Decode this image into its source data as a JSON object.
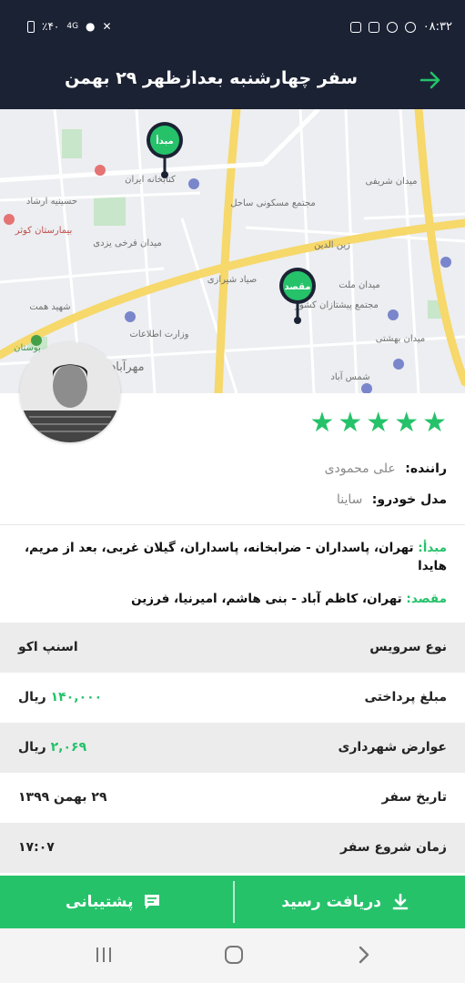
{
  "status_bar": {
    "time": "۰۸:۳۲",
    "battery": "٪۴۰",
    "network": "4G"
  },
  "header": {
    "title": "سفر چهارشنبه بعدازظهر ۲۹ بهمن",
    "back_icon": "arrow-right-icon"
  },
  "map": {
    "origin_marker": "مبدأ",
    "destination_marker": "مقصد",
    "places": [
      "حسینیه ارشاد",
      "بیمارستان کوثر",
      "میدان شریفی",
      "مجتمع مسکونی ساحل",
      "زین الدین",
      "شهید همت",
      "میدان ملت",
      "مجتمع پیشتازان کشور",
      "میدان بهشتی",
      "شمس آباد",
      "وزارت اطلاعات",
      "میدان فرخی یزدی",
      "بوستان",
      "مهرآباد",
      "صیاد شیرازی",
      "کتابخانه ایران"
    ]
  },
  "driver": {
    "rating": 5,
    "name_label": "راننده:",
    "name": "علی  محمودی",
    "car_label": "مدل خودرو:",
    "car": "ساینا"
  },
  "addresses": {
    "origin_label": "مبدأ:",
    "origin": "تهران، پاسداران - ضرابخانه، پاسداران، گیلان غربی، بعد از مریم، هایدا",
    "destination_label": "مقصد:",
    "destination": "تهران، کاظم آباد - بنی هاشم، امیرنیا، فرزین"
  },
  "details": [
    {
      "label": "نوع سرویس",
      "value": "اسنپ اکو",
      "num": "",
      "unit": ""
    },
    {
      "label": "مبلغ پرداختی",
      "value": "",
      "num": "۱۴۰,۰۰۰",
      "unit": "ریال"
    },
    {
      "label": "عوارض شهرداری",
      "value": "",
      "num": "۲,۰۶۹",
      "unit": "ریال"
    },
    {
      "label": "تاریخ سفر",
      "value": "۲۹ بهمن ۱۳۹۹",
      "num": "",
      "unit": ""
    },
    {
      "label": "زمان شروع سفر",
      "value": "۱۷:۰۷",
      "num": "",
      "unit": ""
    }
  ],
  "actions": {
    "receipt": "دریافت رسید",
    "support": "پشتیبانی"
  },
  "colors": {
    "header_bg": "#1b2234",
    "accent": "#25c26a"
  }
}
